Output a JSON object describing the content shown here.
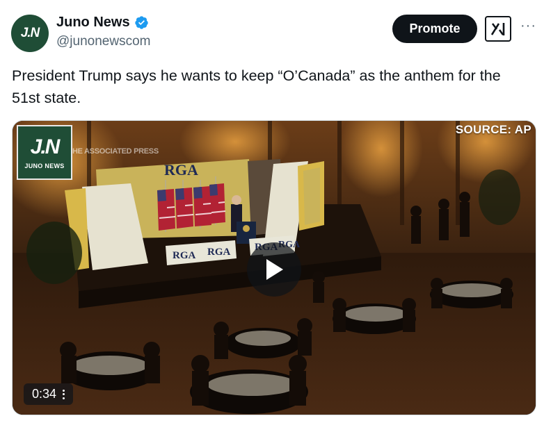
{
  "author": {
    "display_name": "Juno News",
    "handle": "@junonewscom",
    "avatar_text": "J.N",
    "verified": true,
    "verified_color": "#1d9bf0"
  },
  "actions": {
    "promote_label": "Promote",
    "grok_icon": "grok-icon",
    "more_label": "···"
  },
  "tweet": {
    "text": "President Trump says he wants to keep “O’Canada” as the anthem for the 51st state."
  },
  "media": {
    "logo_mark": "J.N",
    "logo_text": "JUNO NEWS",
    "watermark": "HE ASSOCIATED PRESS",
    "source_label": "SOURCE: AP",
    "stage_sign": "RGA",
    "podium_signs": [
      "RGA",
      "RGA",
      "RGA",
      "RGA"
    ],
    "duration": "0:34",
    "play_icon": "play-icon"
  },
  "colors": {
    "brand_green": "#1f4d36",
    "text": "#0f1419",
    "secondary": "#536471"
  }
}
